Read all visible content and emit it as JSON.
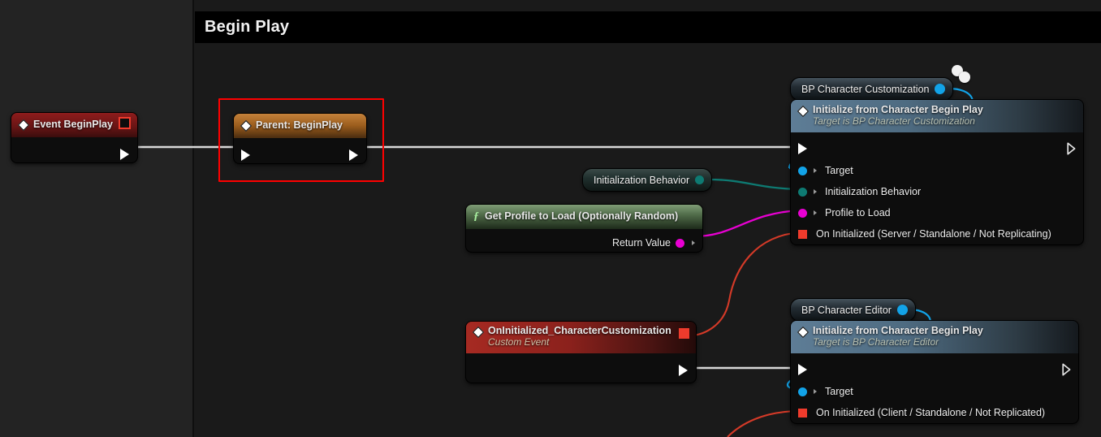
{
  "graph": {
    "title": "Begin Play",
    "background_color": "#1a1a1a",
    "left_panel_color": "#232323"
  },
  "colors": {
    "exec_wire": "#d8d8d8",
    "object_pin": "#12a3e8",
    "enum_pin": "#0e7a72",
    "struct_pin": "#e800d2",
    "delegate_pin": "#ef3b2c",
    "event_header": "#a32222",
    "parent_header": "#a8601c",
    "function_header": "#5d7d56",
    "call_header": "#5b7b94",
    "selection": "#ff0000"
  },
  "nodes": {
    "event_begin_play": {
      "title": "Event BeginPlay",
      "icon": "event-diamond-icon",
      "delegate_pin_name": "delegate-output-pin",
      "exec_out_name": "exec-output-pin"
    },
    "parent_begin_play": {
      "title": "Parent: BeginPlay",
      "icon": "event-diamond-icon",
      "selected": true
    },
    "initialization_behavior_var": {
      "title": "Initialization Behavior",
      "pin_color": "#0e7a72"
    },
    "get_profile_to_load": {
      "title": "Get Profile to Load (Optionally Random)",
      "icon": "function-f-icon",
      "output_pin_label": "Return Value",
      "output_pin_color": "#e800d2"
    },
    "bp_character_customization_var": {
      "title": "BP Character Customization",
      "pin_color": "#12a3e8"
    },
    "init_from_character_begin_play_customization": {
      "title": "Initialize from Character Begin Play",
      "subtitle": "Target is BP Character Customization",
      "icon": "event-diamond-icon",
      "pins": [
        {
          "label": "Target",
          "shape": "circle",
          "color": "#12a3e8",
          "name": "pin-target"
        },
        {
          "label": "Initialization Behavior",
          "shape": "circle",
          "color": "#0e7a72",
          "name": "pin-initialization-behavior"
        },
        {
          "label": "Profile to Load",
          "shape": "circle",
          "color": "#e800d2",
          "name": "pin-profile-to-load"
        },
        {
          "label": "On Initialized (Server / Standalone / Not Replicating)",
          "shape": "square",
          "color": "#ef3b2c",
          "name": "pin-on-initialized-server"
        }
      ]
    },
    "on_initialized_custom_event": {
      "title": "OnInitialized_CharacterCustomization",
      "subtitle": "Custom Event",
      "icon": "event-diamond-icon",
      "delegate_pin_color": "#ef3b2c"
    },
    "bp_character_editor_var": {
      "title": "BP Character Editor",
      "pin_color": "#12a3e8"
    },
    "init_from_character_begin_play_editor": {
      "title": "Initialize from Character Begin Play",
      "subtitle": "Target is BP Character Editor",
      "icon": "event-diamond-icon",
      "pins": [
        {
          "label": "Target",
          "shape": "circle",
          "color": "#12a3e8",
          "name": "pin-target"
        },
        {
          "label": "On Initialized (Client / Standalone / Not Replicated)",
          "shape": "square",
          "color": "#ef3b2c",
          "name": "pin-on-initialized-client"
        }
      ]
    }
  }
}
